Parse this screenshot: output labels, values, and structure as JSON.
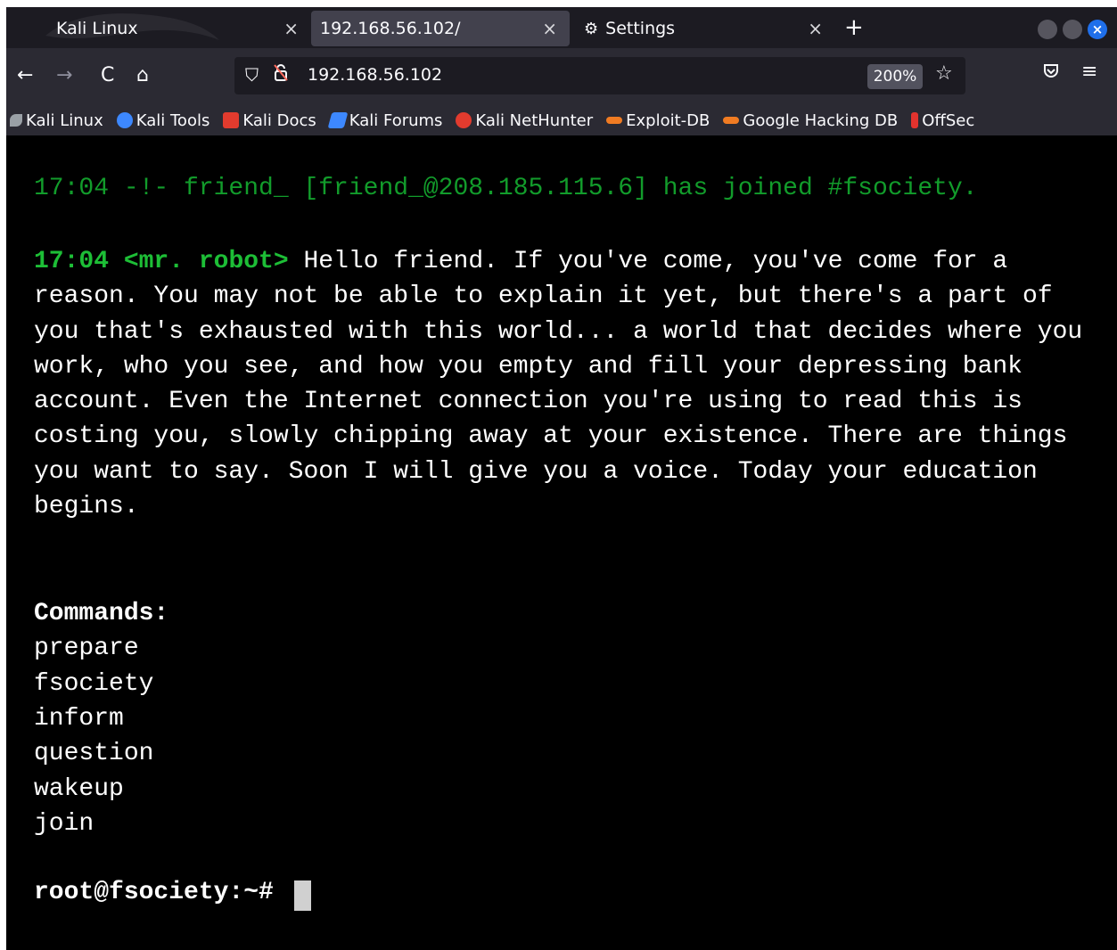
{
  "tabs": [
    {
      "label": "Kali Linux",
      "close": "×"
    },
    {
      "label": "192.168.56.102/",
      "close": "×"
    },
    {
      "label": "Settings",
      "close": "×",
      "icon": "gear-icon"
    }
  ],
  "new_tab_label": "+",
  "window_close_glyph": "×",
  "nav": {
    "back": "←",
    "forward": "→",
    "reload": "C",
    "home": "⌂",
    "url": "192.168.56.102",
    "zoom": "200%",
    "star": "☆",
    "menu": "≡"
  },
  "bookmarks": [
    {
      "label": "Kali Linux",
      "icon": "kali-dragon-icon",
      "color": "#9aa0a6"
    },
    {
      "label": "Kali Tools",
      "icon": "kali-tools-icon",
      "color": "#3d88ff"
    },
    {
      "label": "Kali Docs",
      "icon": "kali-docs-icon",
      "color": "#e23b2e"
    },
    {
      "label": "Kali Forums",
      "icon": "kali-forums-icon",
      "color": "#3d88ff"
    },
    {
      "label": "Kali NetHunter",
      "icon": "kali-nethunter-icon",
      "color": "#e23b2e"
    },
    {
      "label": "Exploit-DB",
      "icon": "exploit-db-icon",
      "color": "#f07b22"
    },
    {
      "label": "Google Hacking DB",
      "icon": "ghdb-icon",
      "color": "#f07b22"
    },
    {
      "label": "OffSec",
      "icon": "offsec-icon",
      "color": "#e2332e"
    }
  ],
  "terminal": {
    "join_line": "17:04 -!- friend_ [friend_@208.185.115.6] has joined #fsociety.",
    "message_time": "17:04",
    "message_nick": "<mr. robot>",
    "message_text": "Hello friend. If you've come, you've come for a reason. You may not be able to explain it yet, but there's a part of you that's exhausted with this world... a world that decides where you work, who you see, and how you empty and fill your depressing bank account. Even the Internet connection you're using to read this is costing you, slowly chipping away at your existence. There are things you want to say. Soon I will give you a voice. Today your education begins.",
    "commands_title": "Commands:",
    "commands": [
      "prepare",
      "fsociety",
      "inform",
      "question",
      "wakeup",
      "join"
    ],
    "prompt": "root@fsociety:~#"
  }
}
